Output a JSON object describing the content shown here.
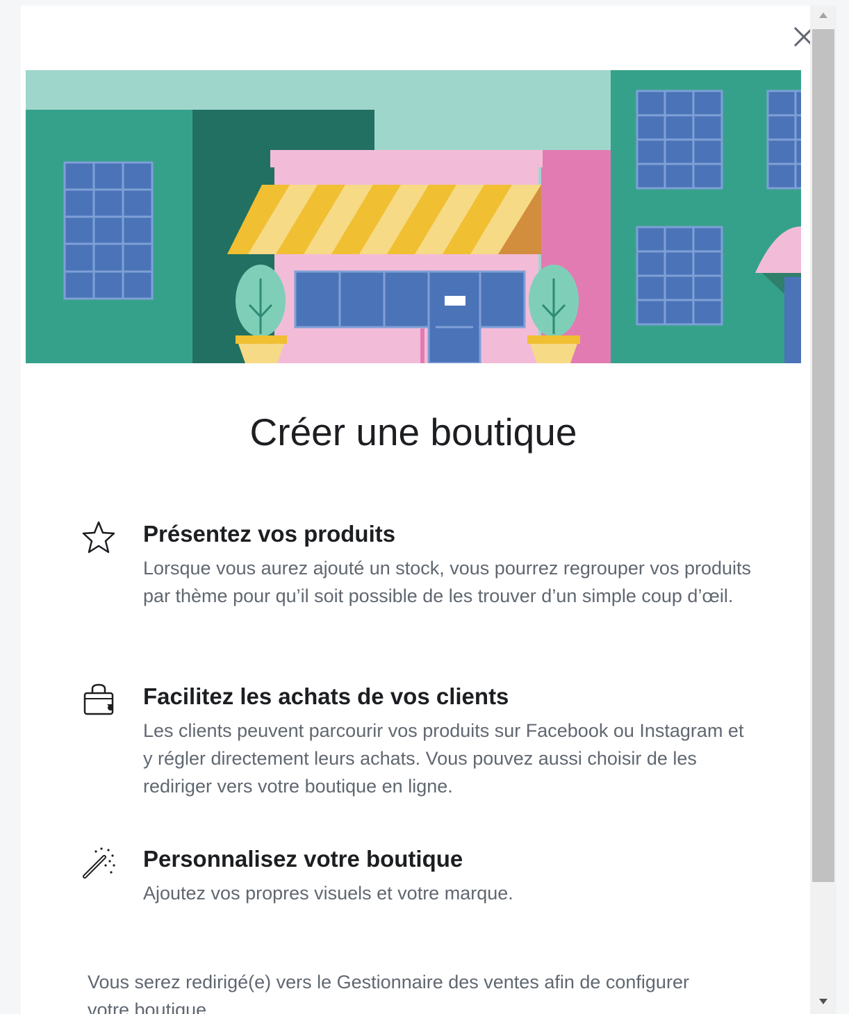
{
  "dialog": {
    "title": "Créer une boutique",
    "close_icon": "close-icon",
    "features": [
      {
        "icon": "star-icon",
        "title": "Présentez vos produits",
        "description": "Lorsque vous aurez ajouté un stock, vous pourrez regrouper vos produits par thème pour qu’il soit possible de les trouver d’un simple coup d’œil."
      },
      {
        "icon": "shopping-bag-icon",
        "title": "Facilitez les achats de vos clients",
        "description": "Les clients peuvent parcourir vos produits sur Facebook ou Instagram et y régler directement leurs achats. Vous pouvez aussi choisir de les rediriger vers votre boutique en ligne."
      },
      {
        "icon": "magic-wand-icon",
        "title": "Personnalisez votre boutique",
        "description": "Ajoutez vos propres visuels et votre marque."
      }
    ],
    "footer_note": "Vous serez redirigé(e) vers le Gestionnaire des ventes afin de configurer votre boutique."
  },
  "colors": {
    "building_green": "#36a18a",
    "building_dark_green": "#227061",
    "sky_mint": "#9fd6cb",
    "shop_pink": "#f2bcd8",
    "accent_pink": "#e27bb1",
    "awning_yellow": "#f0bf32",
    "window_blue": "#4b73b8",
    "text_primary": "#1c1e21",
    "text_secondary": "#606770"
  }
}
